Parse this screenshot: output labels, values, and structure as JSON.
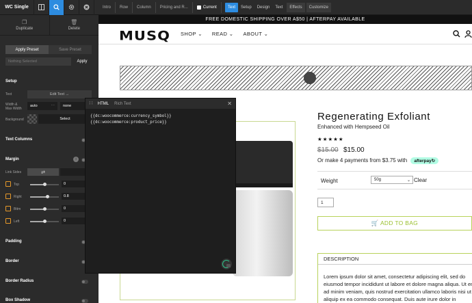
{
  "toolbar": {
    "module_title": "WC Single",
    "breadcrumbs": [
      "Intro",
      "Row",
      "Column",
      "Pricing and R...",
      "Current"
    ],
    "tabs": [
      "Text",
      "Setup",
      "Design",
      "Text",
      "Effects",
      "Customize"
    ]
  },
  "panel": {
    "duplicate_label": "Duplicate",
    "delete_label": "Delete",
    "apply_preset_label": "Apply Preset",
    "save_preset_label": "Save Preset",
    "preset_placeholder": "Nothing Selected",
    "apply_label": "Apply",
    "setup_title": "Setup",
    "text_label": "Text",
    "edit_text_label": "Edit Text →",
    "width_label": "Width &",
    "max_width_label": "Max Width",
    "width_value": "auto",
    "max_width_value": "none",
    "background_label": "Background",
    "select_label": "Select",
    "text_columns_title": "Text Columns",
    "margin_title": "Margin",
    "link_sides_label": "Link Sides",
    "link_icon": "⇄",
    "margins": [
      {
        "label": "Top",
        "value": "0",
        "fraction": 0.5
      },
      {
        "label": "Right",
        "value": "0.8",
        "fraction": 0.6
      },
      {
        "label": "Bttm",
        "value": "0",
        "fraction": 0.5
      },
      {
        "label": "Left",
        "value": "0",
        "fraction": 0.5
      }
    ],
    "padding_title": "Padding",
    "border_title": "Border",
    "border_radius_title": "Border Radius",
    "box_shadow_title": "Box Shadow"
  },
  "site": {
    "shipping_banner": "FREE DOMESTIC SHIPPING OVER A$50 | AFTERPAY AVAILABLE",
    "logo": "MUSQ",
    "nav": [
      "SHOP ⌄",
      "READ ⌄",
      "ABOUT ⌄"
    ],
    "product_title": "Regenerating Exfoliant",
    "product_subtitle": "Enhanced with Hempseed Oil",
    "stars": "★★★★★",
    "old_price": "$15.00",
    "new_price": "$15.00",
    "afterpay_text": "Or make 4 payments from $3.75 with",
    "afterpay_badge": "afterpay↻",
    "weight_label": "Weight",
    "weight_value": "50g",
    "clear_label": "Clear",
    "quantity": "1",
    "add_to_bag": "🛒 ADD TO BAG",
    "description_tab": "DESCRIPTION",
    "description_text": "Lorem ipsum dolor sit amet, consectetur adipiscing elit, sed do eiusmod tempor incididunt ut labore et dolore magna aliqua. Ut enim ad minim veniam, quis nostrud exercitation ullamco laboris nisi ut aliquip ex ea commodo consequat. Duis aute irure dolor in"
  },
  "modal": {
    "tab_html": "HTML",
    "tab_rich": "Rich Text",
    "close": "✕",
    "code_line1": "{{dc:woocommerce:currency_symbol}}",
    "code_line2": "{{dc:woocommerce:product_price}}"
  },
  "colors": {
    "accent_blue": "#2d8ce0",
    "panel_bg": "#2b2b2b",
    "brand_green": "#9ac02e",
    "afterpay_mint": "#b2fce4"
  }
}
